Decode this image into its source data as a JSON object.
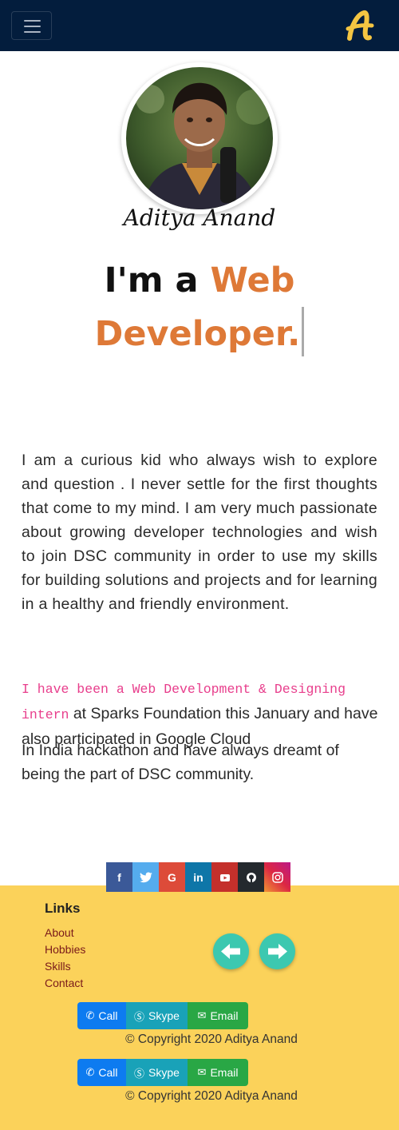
{
  "navbar": {
    "toggle_icon": "hamburger-menu-icon",
    "brand_icon": "logo-a-icon",
    "background": "#031d3d"
  },
  "profile": {
    "name": "Aditya Anand",
    "photo": "profile-photo"
  },
  "headline": {
    "prefix": "I'm a ",
    "role": "Web Developer.",
    "accent": "#de7937"
  },
  "about": {
    "paragraph1": "I am a curious kid who always wish to explore and question . I never settle for the first thoughts that come to my mind. I am very much passionate about growing developer technologies and wish to join DSC community in order to use my skills for building solutions and projects and for learning in a healthy and friendly environment.",
    "intern_highlight": "I have been a Web Development & Designing intern",
    "paragraph2_rest": " at Sparks Foundation this January and have also participated in Google Cloud",
    "paragraph2_line3": "In India hackathon and have always dreamt of being the part of DSC community."
  },
  "social": {
    "items": [
      {
        "icon": "facebook-icon",
        "glyph": "f",
        "color": "#3b5998"
      },
      {
        "icon": "twitter-icon",
        "glyph": "t",
        "color": "#55acee"
      },
      {
        "icon": "google-icon",
        "glyph": "G",
        "color": "#dd4b39"
      },
      {
        "icon": "linkedin-icon",
        "glyph": "in",
        "color": "#0e76a8"
      },
      {
        "icon": "youtube-icon",
        "glyph": "▶",
        "color": "#c4302b"
      },
      {
        "icon": "github-icon",
        "glyph": "◉",
        "color": "#333333"
      },
      {
        "icon": "instagram-icon",
        "glyph": "◎",
        "color": "#c13584"
      }
    ]
  },
  "footer": {
    "links_title": "Links",
    "links": [
      "About",
      "Hobbies",
      "Skills",
      "Contact"
    ],
    "prev_icon": "arrow-left-icon",
    "next_icon": "arrow-right-icon",
    "buttons": {
      "call": "Call",
      "skype": "Skype",
      "email": "Email"
    },
    "copyright": "© Copyright 2020 Aditya Anand",
    "background": "#fbd25a"
  }
}
